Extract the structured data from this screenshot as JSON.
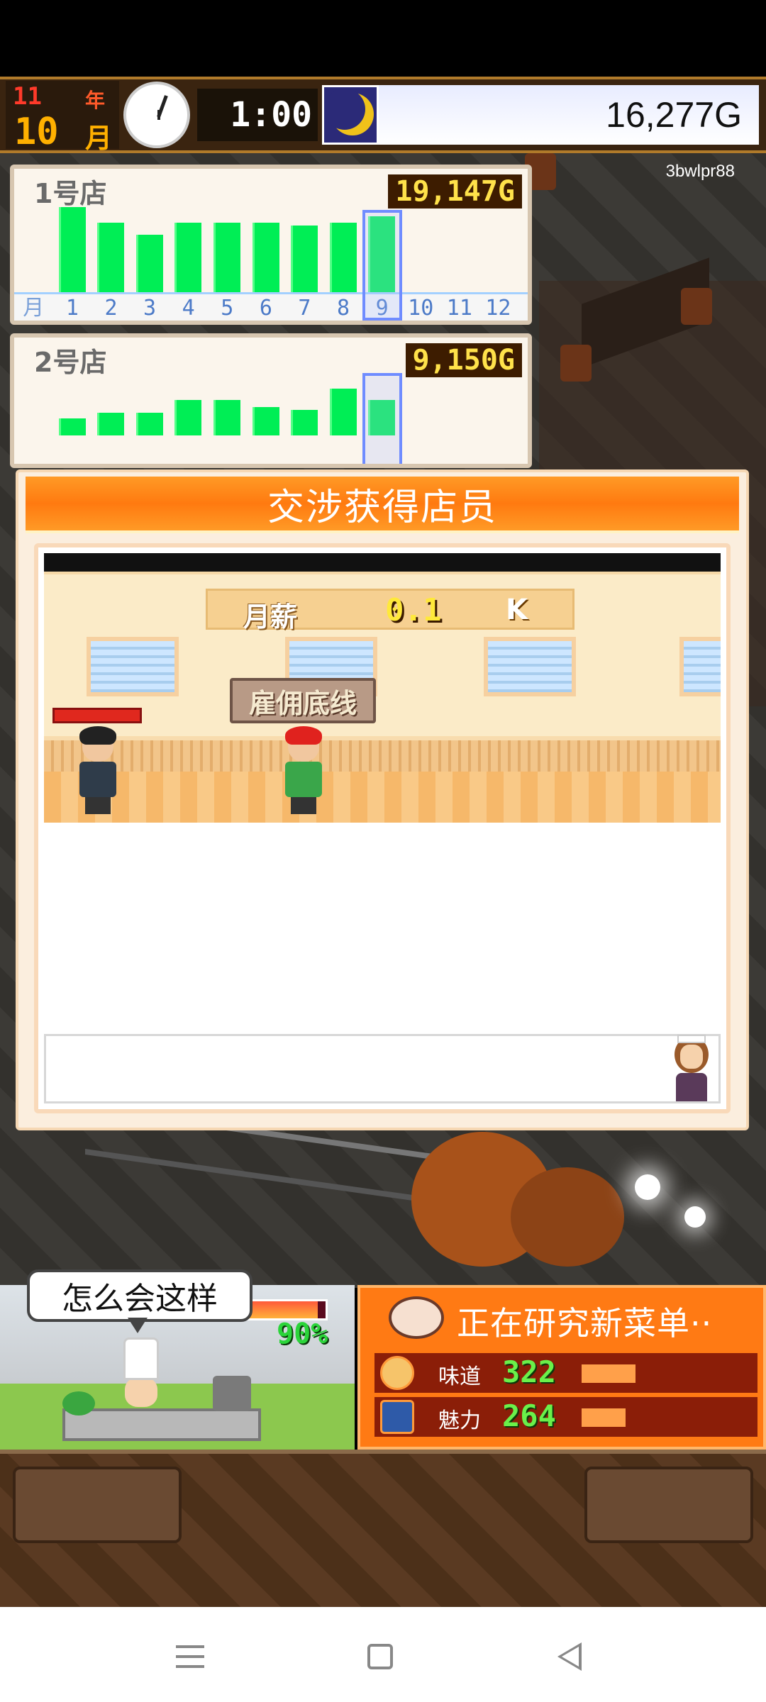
{
  "hud": {
    "year_number": "11",
    "year_label": "年",
    "month_number": "10",
    "month_label": "月",
    "time": "1:00",
    "gold": "16,277G",
    "clock_icon": "analog-clock-icon",
    "time_of_day_icon": "moon-icon"
  },
  "watermark": "3bwlpr88",
  "stores": [
    {
      "name": "1号店",
      "sales": "19,147G",
      "month_axis_label": "月",
      "months": [
        "1",
        "2",
        "3",
        "4",
        "5",
        "6",
        "7",
        "8",
        "9",
        "10",
        "11",
        "12"
      ],
      "current_month": 9,
      "bar_levels": [
        0.98,
        0.8,
        0.66,
        0.8,
        0.8,
        0.8,
        0.77,
        0.8,
        0.88,
        0,
        0,
        0
      ]
    },
    {
      "name": "2号店",
      "sales": "9,150G",
      "current_month": 9,
      "bar_levels": [
        0.18,
        0.24,
        0.24,
        0.38,
        0.38,
        0.3,
        0.27,
        0.5,
        0.38,
        0,
        0,
        0
      ]
    }
  ],
  "dialog": {
    "title": "交涉获得店员",
    "salary_label": "月薪",
    "salary_value": "0.1",
    "salary_unit": "K",
    "hire_badge": "雇佣底线",
    "message": ""
  },
  "kitchen": {
    "speech": "怎么会这样",
    "progress_percent": 90,
    "progress_label": "90%"
  },
  "research": {
    "title": "正在研究新菜单··",
    "stats": [
      {
        "label": "味道",
        "value": "322",
        "icon": "taste-icon",
        "level": 0.33
      },
      {
        "label": "魅力",
        "value": "264",
        "icon": "charm-icon",
        "level": 0.27
      }
    ]
  },
  "colors": {
    "accent_orange": "#ff7a14",
    "bar_green": "#00ee55",
    "gold_yellow": "#ffe24a"
  }
}
